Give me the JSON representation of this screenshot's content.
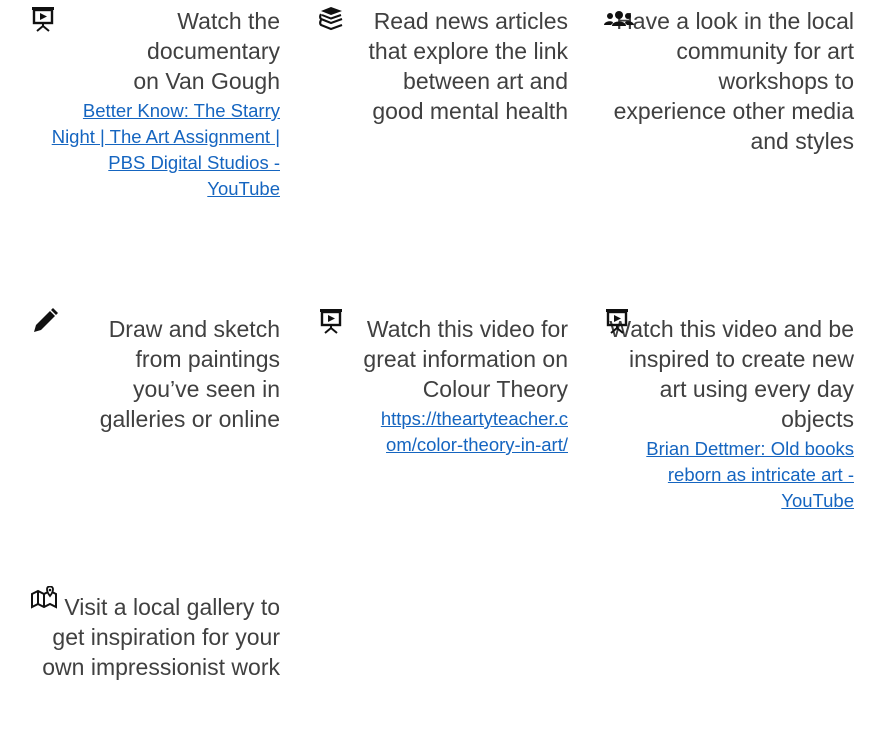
{
  "cards": [
    {
      "icon": "presentation-board-icon",
      "text": "Watch the documentary on Van Gough",
      "link": "Better Know: The Starry Night | The Art Assignment | PBS Digital Studios - YouTube"
    },
    {
      "icon": "books-stack-icon",
      "text": "Read news articles that explore the link between art and good mental health"
    },
    {
      "icon": "users-group-icon",
      "text": "Have a look in the local community for art workshops to experience other media and styles"
    },
    {
      "icon": "pencil-icon",
      "text": "Draw and sketch from paintings you’ve seen in galleries or online"
    },
    {
      "icon": "presentation-board-icon",
      "text": "Watch this video for great information on Colour Theory",
      "link": "https://theartyteacher.com/color-theory-in-art/"
    },
    {
      "icon": "presentation-board-icon",
      "text": "Watch this video and be inspired to create new art using every day objects",
      "link": "Brian Dettmer: Old books reborn as intricate art - YouTube"
    },
    {
      "icon": "map-location-icon",
      "text": "Visit a local gallery to get inspiration for your own impressionist work"
    }
  ]
}
